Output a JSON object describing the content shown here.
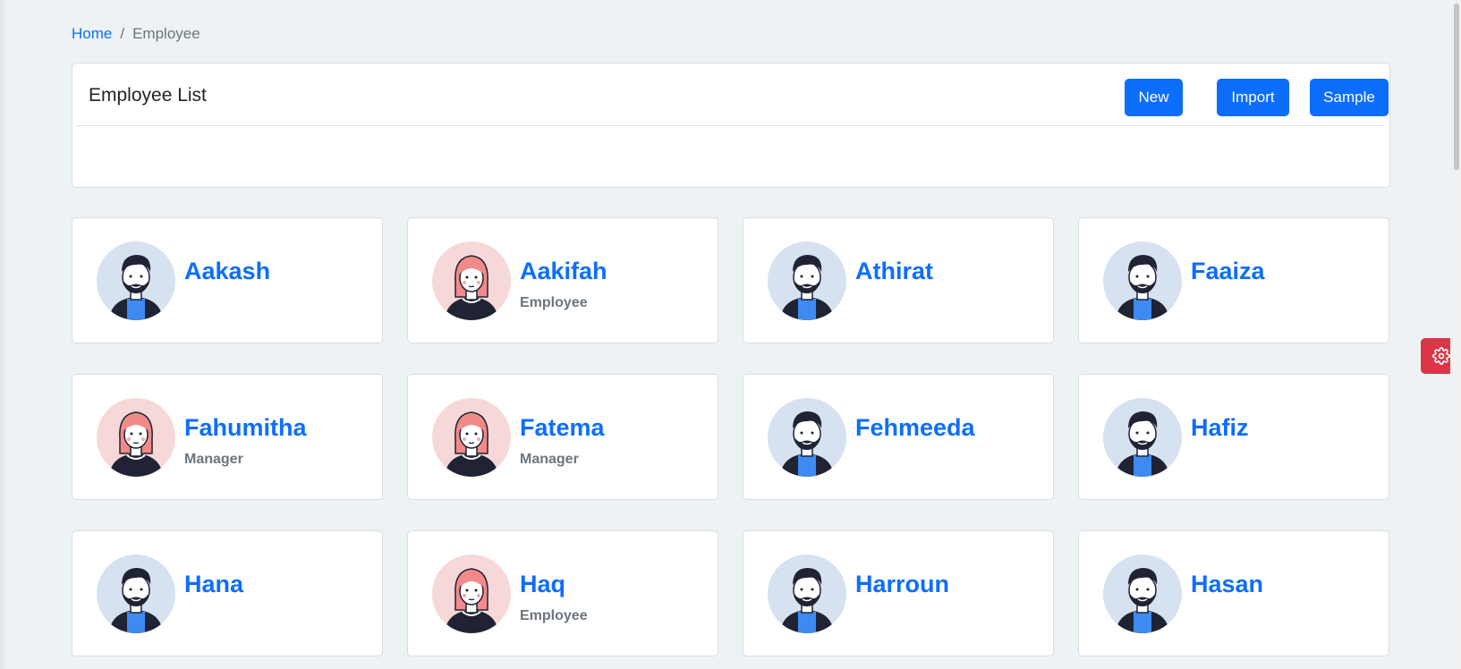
{
  "breadcrumb": {
    "home": "Home",
    "separator": "/",
    "current": "Employee"
  },
  "list_header": {
    "title": "Employee List",
    "new_label": "New",
    "import_label": "Import",
    "sample_label": "Sample"
  },
  "employees": [
    {
      "name": "Aakash",
      "role": "",
      "avatar": "male-avatar-icon"
    },
    {
      "name": "Aakifah",
      "role": "Employee",
      "avatar": "female-avatar-icon"
    },
    {
      "name": "Athirat",
      "role": "",
      "avatar": "male-avatar-icon"
    },
    {
      "name": "Faaiza",
      "role": "",
      "avatar": "male-avatar-icon"
    },
    {
      "name": "Fahumitha",
      "role": "Manager",
      "avatar": "female-avatar-icon"
    },
    {
      "name": "Fatema",
      "role": "Manager",
      "avatar": "female-avatar-icon"
    },
    {
      "name": "Fehmeeda",
      "role": "",
      "avatar": "male-avatar-icon"
    },
    {
      "name": "Hafiz",
      "role": "",
      "avatar": "male-avatar-icon"
    },
    {
      "name": "Hana",
      "role": "",
      "avatar": "male-avatar-icon"
    },
    {
      "name": "Haq",
      "role": "Employee",
      "avatar": "female-avatar-icon"
    },
    {
      "name": "Harroun",
      "role": "",
      "avatar": "male-avatar-icon"
    },
    {
      "name": "Hasan",
      "role": "",
      "avatar": "male-avatar-icon"
    }
  ],
  "settings_icon": "gear-icon",
  "colors": {
    "primary": "#0d6efd",
    "danger": "#dc3545",
    "male_avatar_bg": "#d6e2f0",
    "female_avatar_bg": "#f7d8d8"
  }
}
